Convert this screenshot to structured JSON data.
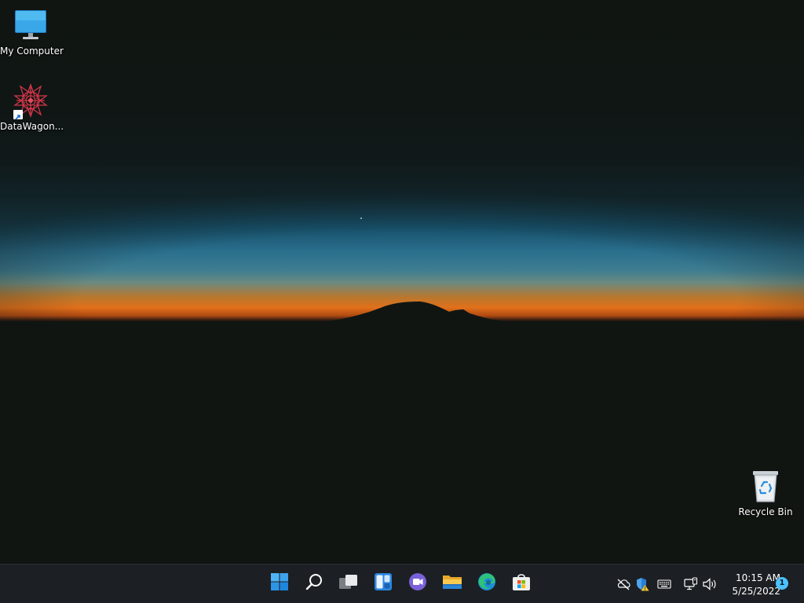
{
  "desktop": {
    "icons": [
      {
        "label": "My Computer",
        "icon": "monitor-icon"
      },
      {
        "label": "DataWagon...",
        "icon": "datawagon-logo-icon",
        "shortcut": true
      },
      {
        "label": "Recycle Bin",
        "icon": "recycle-bin-icon"
      }
    ],
    "wallpaper": {
      "colors": {
        "sky_top": "#0f1513",
        "sky_blue": "#17506a",
        "horizon_orange": "#e2701a",
        "ground": "#101512"
      }
    }
  },
  "taskbar": {
    "background": "#1c2024",
    "pinned": [
      {
        "name": "start-button",
        "icon": "windows-logo-icon"
      },
      {
        "name": "search-button",
        "icon": "search-icon"
      },
      {
        "name": "task-view-button",
        "icon": "task-view-icon"
      },
      {
        "name": "widgets-button",
        "icon": "widgets-icon"
      },
      {
        "name": "chat-button",
        "icon": "teams-chat-icon"
      },
      {
        "name": "file-explorer-button",
        "icon": "folder-icon"
      },
      {
        "name": "edge-button",
        "icon": "edge-icon"
      },
      {
        "name": "store-button",
        "icon": "store-icon"
      }
    ],
    "tray": [
      {
        "name": "network-hidden-icon",
        "icon": "cloud-off-icon"
      },
      {
        "name": "security-warning-icon",
        "icon": "shield-warning-icon"
      },
      {
        "name": "keyboard-icon",
        "icon": "keyboard-icon"
      },
      {
        "name": "network-icon",
        "icon": "network-monitor-icon"
      },
      {
        "name": "volume-icon",
        "icon": "speaker-icon"
      }
    ],
    "clock": {
      "time": "10:15 AM",
      "date": "5/25/2022"
    },
    "notification_count": "1"
  }
}
